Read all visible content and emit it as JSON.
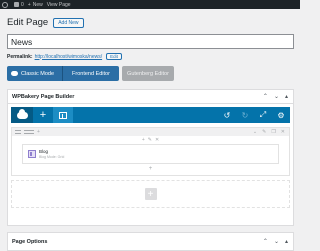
{
  "adminbar": {
    "comments_count": "0",
    "new_label": "New",
    "view_page_label": "View Page"
  },
  "header": {
    "title": "Edit Page",
    "add_new_label": "Add New"
  },
  "post_title": {
    "value": "News"
  },
  "permalink": {
    "label": "Permalink:",
    "url": "http://localhost/wimoska/news/",
    "edit_label": "Edit"
  },
  "editor_modes": {
    "classic_label": "Classic Mode",
    "frontend_label": "Frontend Editor",
    "gutenberg_label": "Gutenberg Editor"
  },
  "wpbakery": {
    "title": "WPBakery Page Builder",
    "element": {
      "name": "Blog",
      "description": "Blog Mode: Grid"
    }
  },
  "page_options": {
    "title": "Page Options"
  },
  "colors": {
    "accent": "#2b6ea5",
    "navbar": "#0473aa",
    "admin_bar": "#1d2327"
  }
}
